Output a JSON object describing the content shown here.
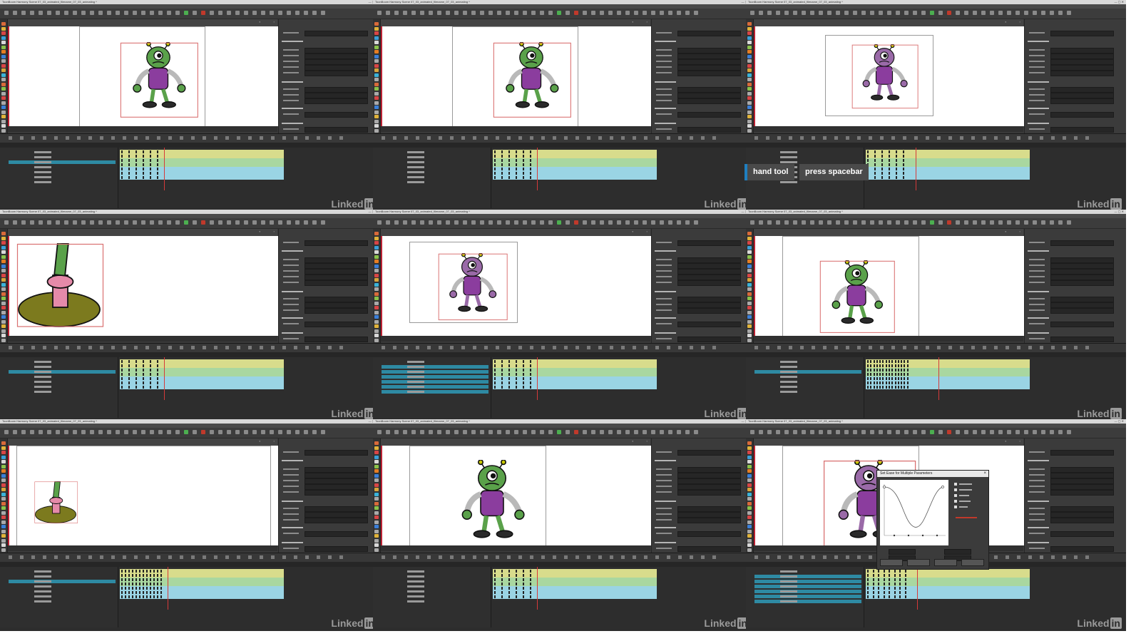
{
  "window_title": "ToonBoom Harmony Scene 07_03_animated_filename_07_03_animating *",
  "watermark": {
    "brand": "Linked",
    "in": "in"
  },
  "caption": {
    "key": "hand tool",
    "action": "press spacebar"
  },
  "dialog": {
    "title": "Set Ease for Multiple Parameters"
  },
  "colors": {
    "track_yellow": "#d8dc8c",
    "track_green": "#a9d7a0",
    "track_cyan": "#9ad4e4",
    "selection_blue": "#2e8aa3",
    "playhead_red": "#d63a3a",
    "caption_accent": "#1f7fc0"
  },
  "tiles": [
    {
      "scene": "character-full"
    },
    {
      "scene": "character-arm"
    },
    {
      "scene": "character-purple-small"
    },
    {
      "scene": "foot-closeup"
    },
    {
      "scene": "character-purple-framed"
    },
    {
      "scene": "character-arm-rotate"
    },
    {
      "scene": "foot-small"
    },
    {
      "scene": "character-green"
    },
    {
      "scene": "character-purple-dialog"
    }
  ]
}
